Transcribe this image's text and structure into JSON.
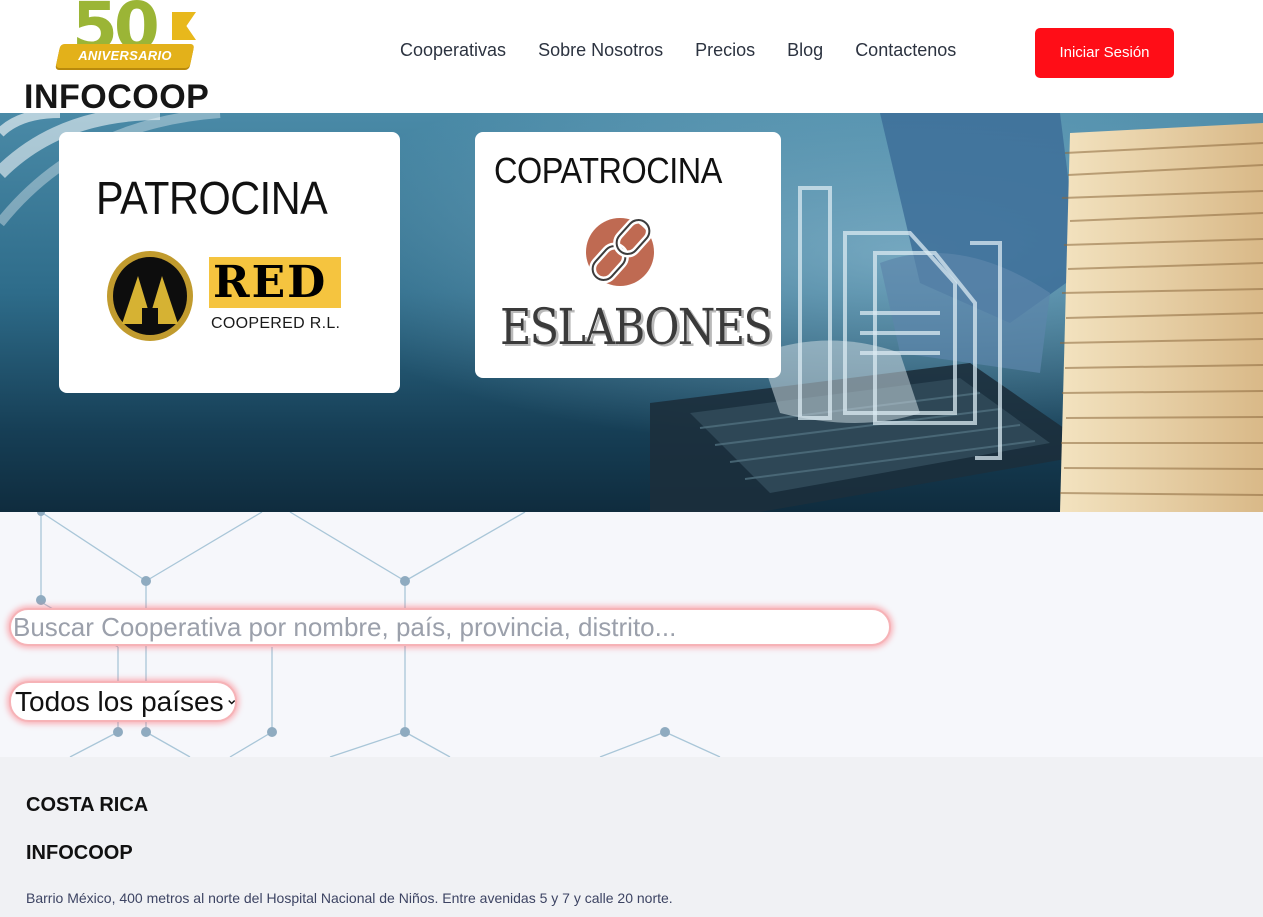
{
  "brand": {
    "anniversary_number": "50",
    "anniversary_label": "ANIVERSARIO",
    "name": "INFOCOOP"
  },
  "nav": {
    "items": [
      "Cooperativas",
      "Sobre Nosotros",
      "Precios",
      "Blog",
      "Contactenos"
    ],
    "login_label": "Iniciar Sesión"
  },
  "hero": {
    "sponsor_title": "PATROCINA",
    "sponsor_logo_word": "RED",
    "sponsor_logo_sub": "COOPERED R.L.",
    "cosponsor_title": "COPATROCINA",
    "cosponsor_logo_word": "ESLABONES"
  },
  "search": {
    "placeholder": "Buscar Cooperativa por nombre, país, provincia, distrito...",
    "country_selected": "Todos los países"
  },
  "footer": {
    "country": "COSTA RICA",
    "org": "INFOCOOP",
    "address": "Barrio México, 400 metros al norte del Hospital Nacional de Niños. Entre avenidas 5 y 7 y calle 20 norte."
  },
  "colors": {
    "accent_red": "#ff0d17",
    "logo_green": "#9bb536",
    "logo_gold": "#e3b11a",
    "input_glow": "#f6b3b7"
  }
}
